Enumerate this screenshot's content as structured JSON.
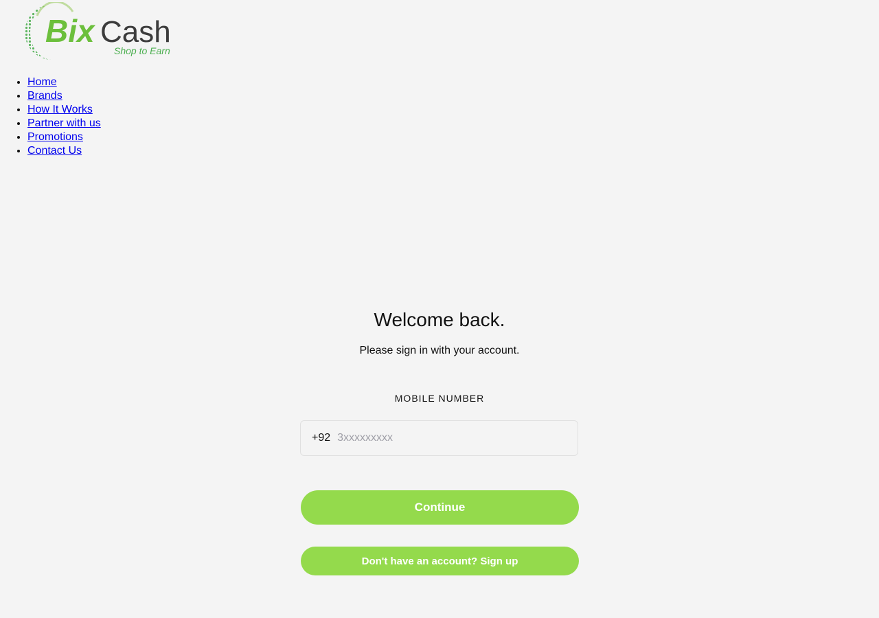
{
  "brand": {
    "name_part1": "Bix",
    "name_part2": "Cash",
    "tagline": "Shop to Earn",
    "colors": {
      "green_dark": "#3a9b3f",
      "green_light": "#8cc63f",
      "gray": "#3c3c3c"
    }
  },
  "nav": {
    "items": [
      {
        "label": "Home"
      },
      {
        "label": "Brands"
      },
      {
        "label": "How It Works"
      },
      {
        "label": "Partner with us"
      },
      {
        "label": "Promotions"
      },
      {
        "label": "Contact Us"
      }
    ]
  },
  "login": {
    "title": "Welcome back.",
    "subtitle": "Please sign in with your account.",
    "field_label": "MOBILE NUMBER",
    "country_prefix": "+92",
    "phone_value": "",
    "phone_placeholder": "3xxxxxxxxx",
    "continue_label": "Continue",
    "signup_label": "Don't have an account? Sign up"
  },
  "colors": {
    "background": "#f4f4f4",
    "button": "#94da4c",
    "link": "#0000ee"
  }
}
